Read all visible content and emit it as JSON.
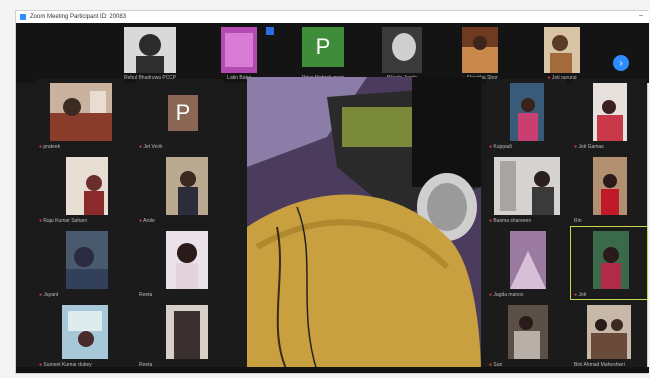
{
  "window": {
    "title": "Zoom Meeting Participant ID: 20083",
    "minimize": "–"
  },
  "top_strip": [
    {
      "label": "Rehul Bhadruwa PCCP"
    },
    {
      "label": "Latin Batuj"
    },
    {
      "label": ""
    },
    {
      "label": "Priya Mehrah-main",
      "avatar": "P"
    },
    {
      "label": "Nikeda Jagde"
    },
    {
      "label": "Shrubha Shor"
    },
    {
      "label": "Joti gurung"
    }
  ],
  "left_grid": [
    {
      "label": "prateek"
    },
    {
      "label": "Jet Verik",
      "avatar": "P"
    },
    {
      "label": "Raju Kumar Sahani"
    },
    {
      "label": "Arole"
    },
    {
      "label": "Jayant"
    },
    {
      "label": "Reeta"
    },
    {
      "label": "Sumeet Kumar dubey"
    },
    {
      "label": "Reeta"
    }
  ],
  "right_grid": [
    {
      "label": "Kuppadi"
    },
    {
      "label": "Joti Gamas"
    },
    {
      "label": "Basma shareeen"
    },
    {
      "label": "Rin"
    },
    {
      "label": "Jagda manos"
    },
    {
      "label": "Joti"
    },
    {
      "label": "Sun"
    },
    {
      "label": "Bini Ahmad Maheshwri"
    }
  ],
  "colors": {
    "accent": "#2d8cff",
    "speaker_outline": "#c8d64a",
    "muted": "#e53935"
  },
  "icons": {
    "next_page": "chevron-right-icon",
    "mic_muted": "mic-off-icon"
  }
}
